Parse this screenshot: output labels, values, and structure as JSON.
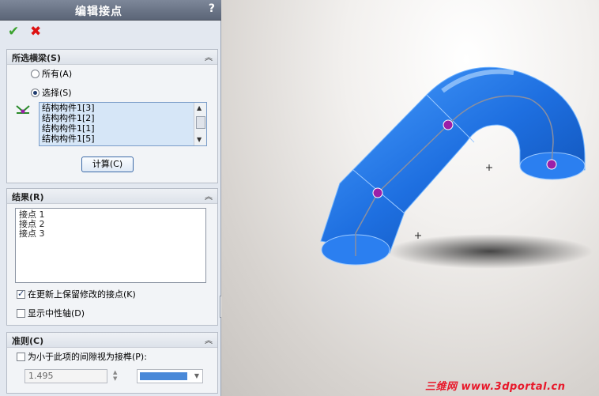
{
  "title": "编辑接点",
  "help": "?",
  "actions": {
    "ok_icon": "checkmark-icon",
    "cancel_icon": "x-icon"
  },
  "members_section": {
    "label": "所选横梁(S)",
    "radio_all": "所有(A)",
    "radio_select": "选择(S)",
    "selected_radio": "select",
    "list": [
      "结构构件1[3]",
      "结构构件1[2]",
      "结构构件1[1]",
      "结构构件1[5]"
    ],
    "calc_button": "计算(C)"
  },
  "results_section": {
    "label": "结果(R)",
    "items": [
      "接点 1",
      "接点 2",
      "接点 3"
    ],
    "keep_modified_label": "在更新上保留修改的接点(K)",
    "keep_modified": true,
    "show_neutral_axis_label": "显示中性轴(D)",
    "show_neutral_axis": false
  },
  "criteria_section": {
    "label": "准则(C)",
    "gap_label": "为小于此项的间隙视为接榫(P):",
    "gap_checked": false,
    "gap_value": "1.495"
  },
  "watermark": "三维网 www.3dportal.cn",
  "colors": {
    "pipe": "#1e6fe0",
    "joint": "#9b1fa8",
    "accent_green": "#3ba22e",
    "accent_red": "#d11111"
  }
}
